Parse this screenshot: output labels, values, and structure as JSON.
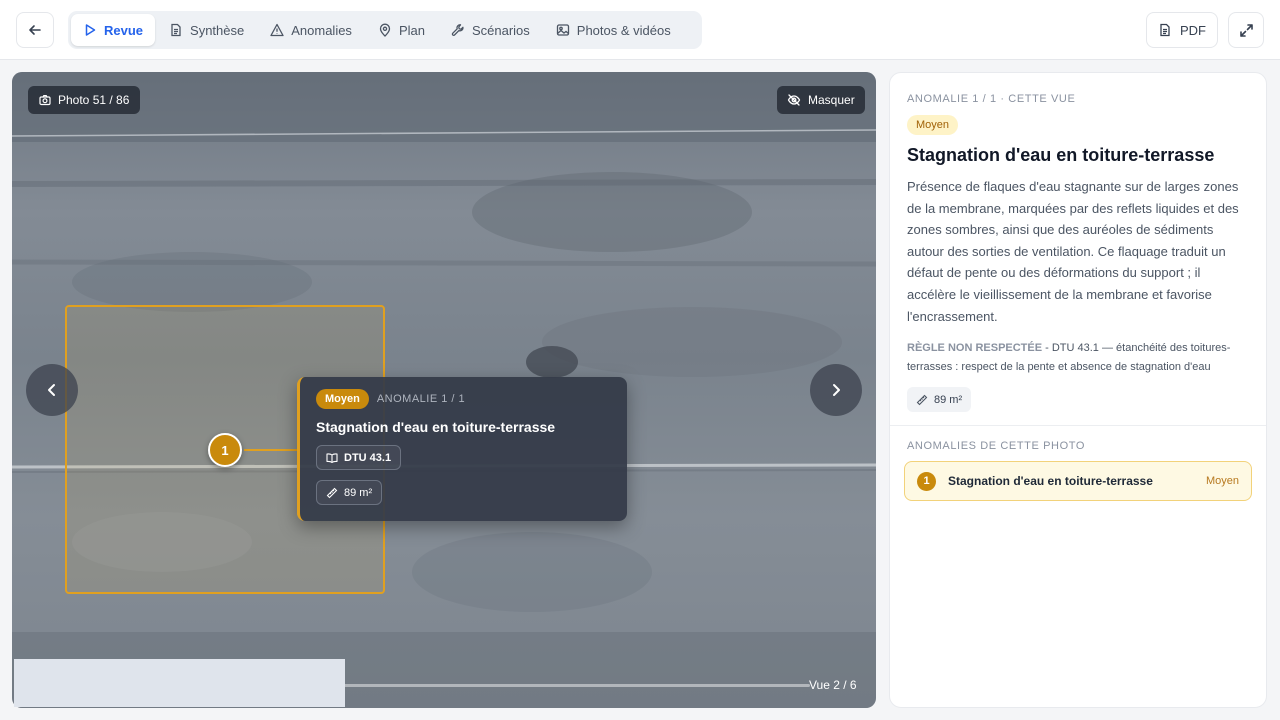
{
  "toolbar": {
    "tabs": [
      {
        "label": "Revue",
        "icon": "play-icon",
        "active": true
      },
      {
        "label": "Synthèse",
        "icon": "document-icon"
      },
      {
        "label": "Anomalies",
        "icon": "warning-icon"
      },
      {
        "label": "Plan",
        "icon": "map-pin-icon"
      },
      {
        "label": "Scénarios",
        "icon": "wrench-icon"
      },
      {
        "label": "Photos & vidéos",
        "icon": "photo-icon"
      }
    ],
    "pdf_label": "PDF",
    "accent": "#2563eb"
  },
  "viewer": {
    "photo_counter": "Photo 51 / 86",
    "hide_label": "Masquer",
    "marker_label": "1",
    "view_counter": "Vue 2 / 6",
    "popup": {
      "severity": "Moyen",
      "counter": "ANOMALIE 1 / 1",
      "title": "Stagnation d'eau en toiture-terrasse",
      "reference": "DTU 43.1",
      "area": "89 m²"
    },
    "highlight_color": "#e0a020"
  },
  "panel": {
    "eyebrow": "ANOMALIE 1 / 1 · CETTE VUE",
    "severity": "Moyen",
    "title": "Stagnation d'eau en toiture-terrasse",
    "description": "Présence de flaques d'eau stagnante sur de larges zones de la membrane, marquées par des reflets liquides et des zones sombres, ainsi que des auréoles de sédiments autour des sorties de ventilation. Ce flaquage traduit un défaut de pente ou des déformations du support ; il accélère le vieillissement de la membrane et favorise l'encrassement.",
    "rule_label": "RÈGLE NON RESPECTÉE",
    "rule_text": " - DTU 43.1 — étanchéité des toitures-terrasses : respect de la pente et absence de stagnation d'eau",
    "area": "89 m²",
    "photo_anomalies_heading": "ANOMALIES DE CETTE PHOTO",
    "photo_anomalies": [
      {
        "number": "1",
        "title": "Stagnation d'eau en toiture-terrasse",
        "severity": "Moyen"
      }
    ],
    "severity_color": "#c98a0c"
  }
}
